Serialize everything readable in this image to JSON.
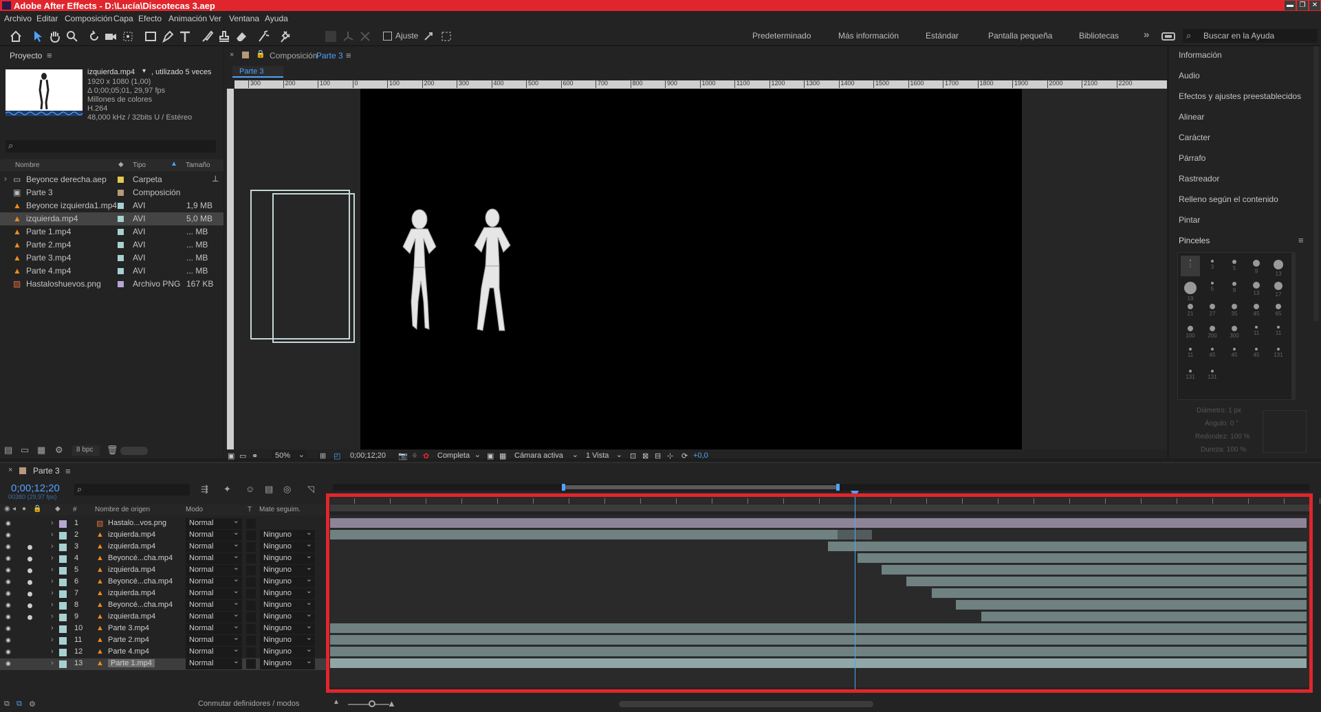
{
  "window": {
    "title": "Adobe After Effects - D:\\Lucía\\Discotecas 3.aep",
    "app_badge": "Ae",
    "controls": [
      "▬",
      "❐",
      "✕"
    ]
  },
  "menu": [
    "Archivo",
    "Editar",
    "Composición",
    "Capa",
    "Efecto",
    "Animación",
    "Ver",
    "Ventana",
    "Ayuda"
  ],
  "toolbar": {
    "snap_label": "Ajuste",
    "workspaces": [
      "Predeterminado",
      "Más información",
      "Estándar",
      "Pantalla pequeña",
      "Bibliotecas"
    ],
    "more": "»",
    "search_placeholder": "Buscar en la Ayuda"
  },
  "project": {
    "title": "Proyecto",
    "selected": {
      "name": "izquierda.mp4",
      "used": ", utilizado 5 veces",
      "resolution": "1920 x 1080 (1,00)",
      "duration": "Δ 0;00;05;01, 29,97 fps",
      "colors": "Millones de colores",
      "codec": "H.264",
      "audio": "48,000 kHz / 32bits U / Estéreo"
    },
    "columns": {
      "name": "Nombre",
      "type": "Tipo",
      "size": "Tamaño"
    },
    "items": [
      {
        "name": "Beyonce derecha.aep",
        "type": "Carpeta",
        "size": "",
        "label_color": "#e3c94f",
        "icon": "folder-icon"
      },
      {
        "name": "Parte 3",
        "type": "Composición",
        "size": "",
        "label_color": "#b6997a",
        "icon": "composition-icon"
      },
      {
        "name": "Beyonce izquierda1.mp4",
        "type": "AVI",
        "size": "1,9 MB",
        "label_color": "#a7d1d1",
        "icon": "vlc-cone-icon"
      },
      {
        "name": "izquierda.mp4",
        "type": "AVI",
        "size": "5,0 MB",
        "label_color": "#a7d1d1",
        "icon": "vlc-cone-icon"
      },
      {
        "name": "Parte 1.mp4",
        "type": "AVI",
        "size": "... MB",
        "label_color": "#a7d1d1",
        "icon": "vlc-cone-icon"
      },
      {
        "name": "Parte 2.mp4",
        "type": "AVI",
        "size": "... MB",
        "label_color": "#a7d1d1",
        "icon": "vlc-cone-icon"
      },
      {
        "name": "Parte 3.mp4",
        "type": "AVI",
        "size": "... MB",
        "label_color": "#a7d1d1",
        "icon": "vlc-cone-icon"
      },
      {
        "name": "Parte 4.mp4",
        "type": "AVI",
        "size": "... MB",
        "label_color": "#a7d1d1",
        "icon": "vlc-cone-icon"
      },
      {
        "name": "Hastaloshuevos.png",
        "type": "Archivo PNG",
        "size": "167 KB",
        "label_color": "#b7a6d4",
        "icon": "image-file-icon"
      }
    ],
    "bpc": "8 bpc"
  },
  "comp_panel": {
    "title_prefix": "Composición",
    "comp_name": "Parte 3",
    "tab": "Parte 3",
    "ruler_labels": [
      "300",
      "200",
      "100",
      "0",
      "100",
      "200",
      "300",
      "400",
      "500",
      "600",
      "700",
      "800",
      "900",
      "1000",
      "1100",
      "1200",
      "1300",
      "1400",
      "1500",
      "1600",
      "1700",
      "1800",
      "1900",
      "2000",
      "2100",
      "2200"
    ],
    "zoom": "50%",
    "timecode": "0;00;12;20",
    "resolution": "Completa",
    "camera": "Cámara activa",
    "views": "1 Vista",
    "exposure": "+0,0"
  },
  "right_panel": {
    "items": [
      "Información",
      "Audio",
      "Efectos y ajustes preestablecidos",
      "Alinear",
      "Carácter",
      "Párrafo",
      "Rastreador",
      "Relleno según el contenido",
      "Pintar"
    ],
    "brushes_title": "Pinceles",
    "brushes": [
      "1",
      "3",
      "5",
      "9",
      "13",
      "19",
      "5",
      "9",
      "13",
      "17",
      "21",
      "27",
      "35",
      "45",
      "65",
      "100",
      "200",
      "300",
      "11",
      "11",
      "11",
      "45",
      "45",
      "45",
      "131",
      "131",
      "131"
    ],
    "params": {
      "diameter": "Diámetro: 1 px",
      "angle": "Ángulo: 0 °",
      "roundness": "Redondez: 100 %",
      "hardness": "Dureza: 100 %"
    }
  },
  "timeline": {
    "tab": "Parte 3",
    "timecode": "0;00;12;20",
    "frames": "00380 (29,97 fps)",
    "columns": {
      "num": "#",
      "source": "Nombre de origen",
      "mode": "Modo",
      "t": "T",
      "matte": "Mate seguim."
    },
    "layers": [
      {
        "num": "1",
        "name": "Hastalo...vos.png",
        "mode": "Normal",
        "matte": "",
        "label_color": "#b7a6d4",
        "solo": false,
        "bar_start": 0.0,
        "bar_end": 1.0,
        "bar_color": "#8e8498"
      },
      {
        "num": "2",
        "name": "izquierda.mp4",
        "mode": "Normal",
        "matte": "Ninguno",
        "label_color": "#a7d1d1",
        "solo": false,
        "bar_start": 0.0,
        "bar_end": 0.52,
        "bar_color": "#6f8181"
      },
      {
        "num": "3",
        "name": "izquierda.mp4",
        "mode": "Normal",
        "matte": "Ninguno",
        "label_color": "#a7d1d1",
        "solo": true,
        "bar_start": 0.51,
        "bar_end": 1.0,
        "bar_color": "#6f8181"
      },
      {
        "num": "4",
        "name": "Beyoncé...cha.mp4",
        "mode": "Normal",
        "matte": "Ninguno",
        "label_color": "#a7d1d1",
        "solo": true,
        "bar_start": 0.54,
        "bar_end": 1.0,
        "bar_color": "#6f8181"
      },
      {
        "num": "5",
        "name": "izquierda.mp4",
        "mode": "Normal",
        "matte": "Ninguno",
        "label_color": "#a7d1d1",
        "solo": true,
        "bar_start": 0.565,
        "bar_end": 1.0,
        "bar_color": "#6f8181"
      },
      {
        "num": "6",
        "name": "Beyoncé...cha.mp4",
        "mode": "Normal",
        "matte": "Ninguno",
        "label_color": "#a7d1d1",
        "solo": true,
        "bar_start": 0.59,
        "bar_end": 1.0,
        "bar_color": "#6f8181"
      },
      {
        "num": "7",
        "name": "izquierda.mp4",
        "mode": "Normal",
        "matte": "Ninguno",
        "label_color": "#a7d1d1",
        "solo": true,
        "bar_start": 0.616,
        "bar_end": 1.0,
        "bar_color": "#6f8181"
      },
      {
        "num": "8",
        "name": "Beyoncé...cha.mp4",
        "mode": "Normal",
        "matte": "Ninguno",
        "label_color": "#a7d1d1",
        "solo": true,
        "bar_start": 0.641,
        "bar_end": 1.0,
        "bar_color": "#6f8181"
      },
      {
        "num": "9",
        "name": "izquierda.mp4",
        "mode": "Normal",
        "matte": "Ninguno",
        "label_color": "#a7d1d1",
        "solo": true,
        "bar_start": 0.667,
        "bar_end": 1.0,
        "bar_color": "#6f8181"
      },
      {
        "num": "10",
        "name": "Parte 3.mp4",
        "mode": "Normal",
        "matte": "Ninguno",
        "label_color": "#a7d1d1",
        "solo": false,
        "bar_start": 0.0,
        "bar_end": 1.0,
        "bar_color": "#6f8181"
      },
      {
        "num": "11",
        "name": "Parte 2.mp4",
        "mode": "Normal",
        "matte": "Ninguno",
        "label_color": "#a7d1d1",
        "solo": false,
        "bar_start": 0.0,
        "bar_end": 1.0,
        "bar_color": "#6f8181"
      },
      {
        "num": "12",
        "name": "Parte 4.mp4",
        "mode": "Normal",
        "matte": "Ninguno",
        "label_color": "#a7d1d1",
        "solo": false,
        "bar_start": 0.0,
        "bar_end": 1.0,
        "bar_color": "#6f8181"
      },
      {
        "num": "13",
        "name": "Parte 1.mp4",
        "mode": "Normal",
        "matte": "Ninguno",
        "label_color": "#a7d1d1",
        "solo": false,
        "bar_start": 0.0,
        "bar_end": 1.0,
        "bar_color": "#8fa7a6"
      }
    ],
    "playhead_position": 0.537,
    "footer": "Conmutar definidores / modos",
    "highlight_color": "#e0262c"
  }
}
